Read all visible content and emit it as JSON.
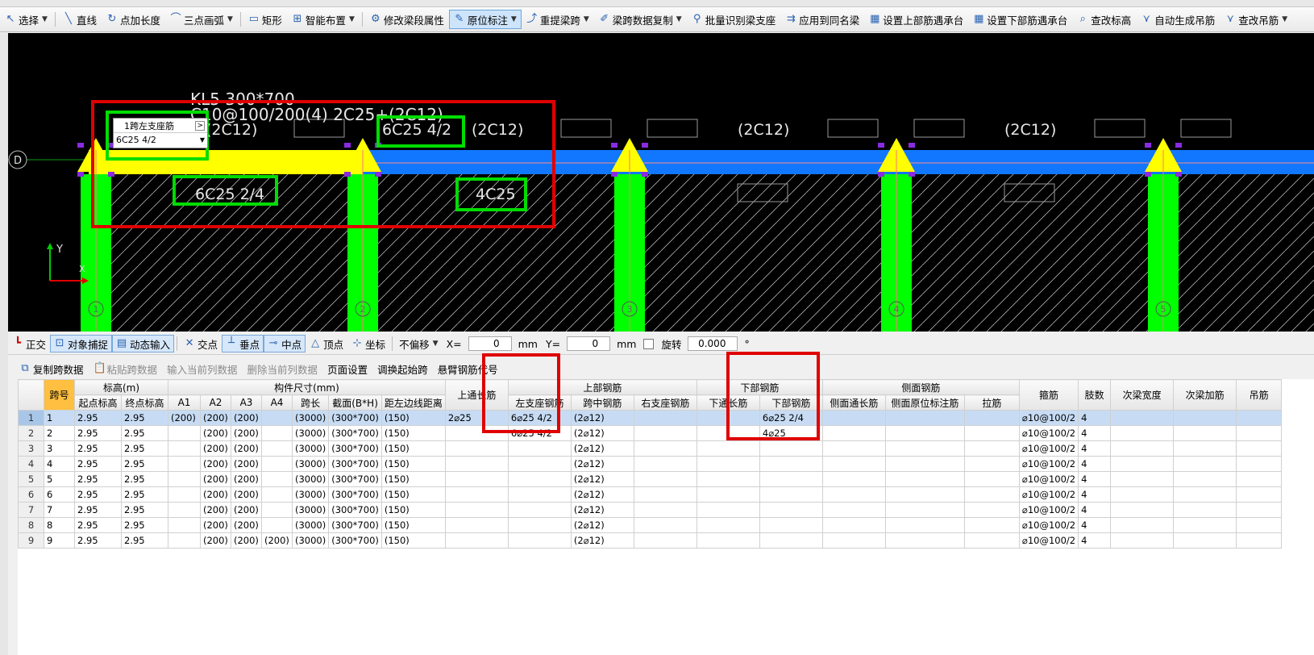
{
  "toolbar": {
    "items": [
      {
        "label": "选择",
        "icon": "cursor-icon",
        "dropdown": true
      },
      {
        "label": "直线",
        "icon": "line-icon"
      },
      {
        "label": "点加长度",
        "icon": "point-length-icon"
      },
      {
        "label": "三点画弧",
        "icon": "arc-icon",
        "dropdown": true
      },
      {
        "label": "矩形",
        "icon": "rectangle-icon"
      },
      {
        "label": "智能布置",
        "icon": "smart-layout-icon",
        "dropdown": true
      },
      {
        "label": "修改梁段属性",
        "icon": "beam-property-icon"
      },
      {
        "label": "原位标注",
        "icon": "annotation-icon",
        "dropdown": true,
        "active": true
      },
      {
        "label": "重提梁跨",
        "icon": "respan-icon",
        "dropdown": true
      },
      {
        "label": "梁跨数据复制",
        "icon": "copy-span-icon",
        "dropdown": true
      },
      {
        "label": "批量识别梁支座",
        "icon": "support-detect-icon"
      },
      {
        "label": "应用到同名梁",
        "icon": "apply-same-icon"
      },
      {
        "label": "设置上部筋遇承台",
        "icon": "top-bar-cap-icon"
      },
      {
        "label": "设置下部筋遇承台",
        "icon": "bottom-bar-cap-icon"
      },
      {
        "label": "查改标高",
        "icon": "elevation-icon"
      },
      {
        "label": "自动生成吊筋",
        "icon": "hanger-auto-icon"
      },
      {
        "label": "查改吊筋",
        "icon": "hanger-edit-icon",
        "dropdown": true
      }
    ]
  },
  "canvas": {
    "beam_name": "KL5 300*700",
    "beam_spec": "C10@100/200(4) 2C25+(2C12)",
    "axis_label": "D",
    "top_texts": [
      "(2C12)",
      "6C25 4/2",
      "(2C12)",
      "(2C12)",
      "(2C12)"
    ],
    "bottom_texts": [
      "6C25 2/4",
      "4C25"
    ],
    "popup_title": "1跨左支座筋",
    "popup_value": "6C25 4/2",
    "axis_numbers": [
      "1",
      "2",
      "3",
      "4",
      "5"
    ],
    "y_label": "Y",
    "x_label": "X",
    "colors": {
      "bg": "#000000",
      "column": "#00ff00",
      "beam_span1": "#ffff00",
      "beam": "#1177ff",
      "support": "#ffff00",
      "annotation_box": "#00dd00",
      "highlight": "#e00000"
    }
  },
  "snapbar": {
    "ortho": "正交",
    "snap": "对象捕捉",
    "dynamic": "动态输入",
    "intersect": "交点",
    "perp": "垂点",
    "mid": "中点",
    "vertex": "顶点",
    "coord": "坐标",
    "offset": "不偏移",
    "x_label": "X=",
    "x_value": "0",
    "mm1": "mm",
    "y_label": "Y=",
    "y_value": "0",
    "mm2": "mm",
    "rotate": "旋转",
    "rotate_value": "0.000",
    "deg": "°"
  },
  "grid_toolbar": {
    "copy": "复制跨数据",
    "paste": "粘贴跨数据",
    "input_col": "输入当前列数据",
    "delete_col": "删除当前列数据",
    "page_setup": "页面设置",
    "swap": "调换起始跨",
    "cantilever": "悬臂钢筋代号"
  },
  "table": {
    "groups": {
      "span": "跨号",
      "elev": "标高(m)",
      "size": "构件尺寸(mm)",
      "top_through": "上通长筋",
      "top": "上部钢筋",
      "bottom": "下部钢筋",
      "side": "侧面钢筋",
      "stirrup": "箍筋",
      "legs": "肢数",
      "sec_width": "次梁宽度",
      "sec_add": "次梁加筋",
      "hanger": "吊筋"
    },
    "sub": {
      "start": "起点标高",
      "end": "终点标高",
      "a1": "A1",
      "a2": "A2",
      "a3": "A3",
      "a4": "A4",
      "len": "跨长",
      "sec": "截面(B*H)",
      "dist": "距左边线距离",
      "left": "左支座钢筋",
      "mid": "跨中钢筋",
      "right": "右支座钢筋",
      "bthrough": "下通长筋",
      "bottom": "下部钢筋",
      "sthrough": "侧面通长筋",
      "sorig": "侧面原位标注筋",
      "tie": "拉筋"
    },
    "rows": [
      [
        "1",
        "1",
        "2.95",
        "2.95",
        "(200)",
        "(200)",
        "(200)",
        "",
        "(3000)",
        "(300*700)",
        "(150)",
        "2⌀25",
        "6⌀25 4/2",
        "(2⌀12)",
        "",
        "",
        "6⌀25 2/4",
        "",
        "",
        "",
        "⌀10@100/2",
        "4",
        "",
        "",
        ""
      ],
      [
        "2",
        "2",
        "2.95",
        "2.95",
        "",
        "(200)",
        "(200)",
        "",
        "(3000)",
        "(300*700)",
        "(150)",
        "",
        "6⌀25 4/2",
        "(2⌀12)",
        "",
        "",
        "4⌀25",
        "",
        "",
        "",
        "⌀10@100/2",
        "4",
        "",
        "",
        ""
      ],
      [
        "3",
        "3",
        "2.95",
        "2.95",
        "",
        "(200)",
        "(200)",
        "",
        "(3000)",
        "(300*700)",
        "(150)",
        "",
        "",
        "(2⌀12)",
        "",
        "",
        "",
        "",
        "",
        "",
        "⌀10@100/2",
        "4",
        "",
        "",
        ""
      ],
      [
        "4",
        "4",
        "2.95",
        "2.95",
        "",
        "(200)",
        "(200)",
        "",
        "(3000)",
        "(300*700)",
        "(150)",
        "",
        "",
        "(2⌀12)",
        "",
        "",
        "",
        "",
        "",
        "",
        "⌀10@100/2",
        "4",
        "",
        "",
        ""
      ],
      [
        "5",
        "5",
        "2.95",
        "2.95",
        "",
        "(200)",
        "(200)",
        "",
        "(3000)",
        "(300*700)",
        "(150)",
        "",
        "",
        "(2⌀12)",
        "",
        "",
        "",
        "",
        "",
        "",
        "⌀10@100/2",
        "4",
        "",
        "",
        ""
      ],
      [
        "6",
        "6",
        "2.95",
        "2.95",
        "",
        "(200)",
        "(200)",
        "",
        "(3000)",
        "(300*700)",
        "(150)",
        "",
        "",
        "(2⌀12)",
        "",
        "",
        "",
        "",
        "",
        "",
        "⌀10@100/2",
        "4",
        "",
        "",
        ""
      ],
      [
        "7",
        "7",
        "2.95",
        "2.95",
        "",
        "(200)",
        "(200)",
        "",
        "(3000)",
        "(300*700)",
        "(150)",
        "",
        "",
        "(2⌀12)",
        "",
        "",
        "",
        "",
        "",
        "",
        "⌀10@100/2",
        "4",
        "",
        "",
        ""
      ],
      [
        "8",
        "8",
        "2.95",
        "2.95",
        "",
        "(200)",
        "(200)",
        "",
        "(3000)",
        "(300*700)",
        "(150)",
        "",
        "",
        "(2⌀12)",
        "",
        "",
        "",
        "",
        "",
        "",
        "⌀10@100/2",
        "4",
        "",
        "",
        ""
      ],
      [
        "9",
        "9",
        "2.95",
        "2.95",
        "",
        "(200)",
        "(200)",
        "(200)",
        "(3000)",
        "(300*700)",
        "(150)",
        "",
        "",
        "(2⌀12)",
        "",
        "",
        "",
        "",
        "",
        "",
        "⌀10@100/2",
        "4",
        "",
        "",
        ""
      ]
    ]
  }
}
